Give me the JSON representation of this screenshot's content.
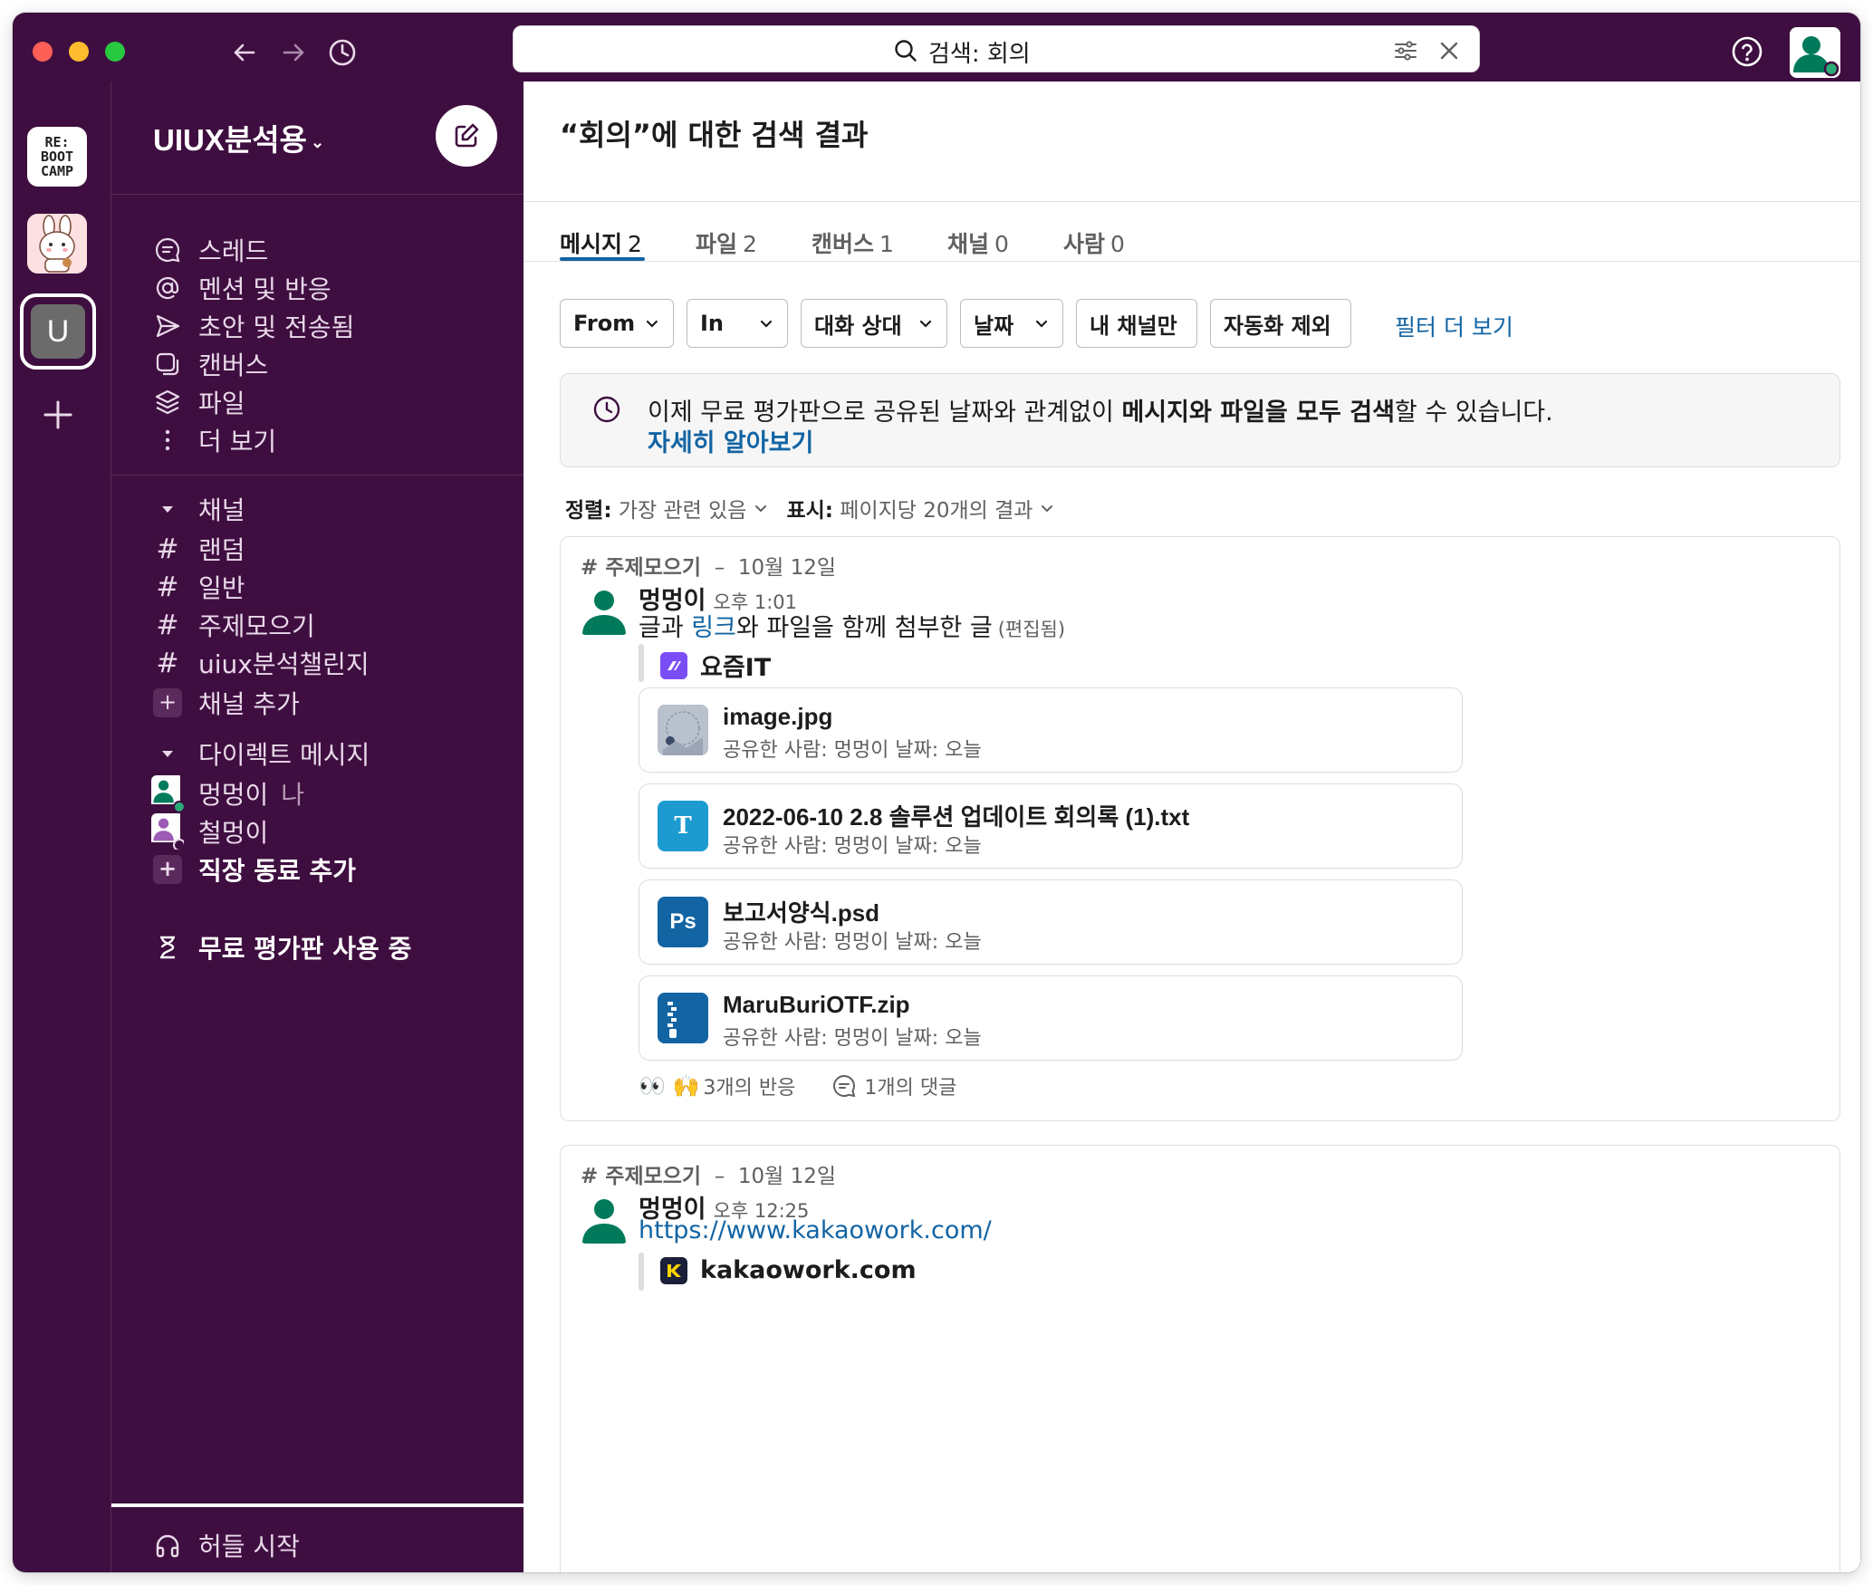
{
  "search": {
    "query": "검색: 회의"
  },
  "rail": {
    "workspace_logo_text": "RE:\nBOOT\nCAMP",
    "current_ws_initial": "U"
  },
  "sidebar": {
    "workspace_name": "UIUX분석용",
    "nav": [
      {
        "label": "스레드",
        "icon": "threads-icon"
      },
      {
        "label": "멘션 및 반응",
        "icon": "mention-icon"
      },
      {
        "label": "초안 및 전송됨",
        "icon": "send-icon"
      },
      {
        "label": "캔버스",
        "icon": "canvas-icon"
      },
      {
        "label": "파일",
        "icon": "files-icon"
      },
      {
        "label": "더 보기",
        "icon": "more-icon"
      }
    ],
    "channels_header": "채널",
    "channels": [
      "랜덤",
      "일반",
      "주제모으기",
      "uiux분석챌린지"
    ],
    "add_channel": "채널 추가",
    "dm_header": "다이렉트 메시지",
    "dms": [
      {
        "name": "멍멍이",
        "suffix": "나",
        "color": "#007a5a",
        "status": "#2bac76"
      },
      {
        "name": "철멍이",
        "suffix": "",
        "color": "#9e5bb5",
        "status": "#ffffff"
      }
    ],
    "add_coworker": "직장 동료 추가",
    "trial": "무료 평가판 사용 중",
    "huddle": "허들 시작"
  },
  "main": {
    "title": "“회의”에 대한 검색 결과",
    "tabs": [
      {
        "label": "메시지",
        "count": "2"
      },
      {
        "label": "파일",
        "count": "2"
      },
      {
        "label": "캔버스",
        "count": "1"
      },
      {
        "label": "채널",
        "count": "0"
      },
      {
        "label": "사람",
        "count": "0"
      }
    ],
    "filters": [
      "From",
      "In",
      "대화 상대",
      "날짜",
      "내 채널만",
      "자동화 제외"
    ],
    "filter_more": "필터 더 보기",
    "notice": {
      "pre": "이제 무료 평가판으로 공유된 날짜와 관계없이 ",
      "bold": "메시지와 파일을 모두 검색",
      "post": "할 수 있습니다.",
      "link": "자세히 알아보기"
    },
    "sort": {
      "sort_label": "정렬:",
      "sort_value": "가장 관련 있음",
      "view_label": "표시:",
      "view_value": "페이지당 20개의 결과"
    },
    "results": [
      {
        "channel": "# 주제모으기",
        "date": "10월 12일",
        "user": "멍멍이",
        "time": "오후 1:01",
        "text_pre": "글과 ",
        "text_link": "링크",
        "text_post": "와 파일을 함께 첨부한 글",
        "edited": "(편집됨)",
        "attachment": "요즘IT",
        "files": [
          {
            "name": "image.jpg",
            "meta": "공유한 사람: 멍멍이 날짜: 오늘",
            "icon": "image-thumbnail-icon"
          },
          {
            "name": "2022-06-10 2.8 솔루션 업데이트 회의록 (1).txt",
            "meta": "공유한 사람: 멍멍이 날짜: 오늘",
            "icon": "text-file-icon",
            "glyph": "T"
          },
          {
            "name": "보고서양식.psd",
            "meta": "공유한 사람: 멍멍이 날짜: 오늘",
            "icon": "photoshop-file-icon",
            "glyph": "Ps"
          },
          {
            "name": "MaruBuriOTF.zip",
            "meta": "공유한 사람: 멍멍이 날짜: 오늘",
            "icon": "zip-file-icon"
          }
        ],
        "reactions": "👀 🙌",
        "reactions_text": "3개의 반응",
        "comments": "1개의 댓글"
      },
      {
        "channel": "# 주제모으기",
        "date": "10월 12일",
        "user": "멍멍이",
        "time": "오후 12:25",
        "link": "https://www.kakaowork.com/",
        "attachment": "kakaowork.com"
      }
    ]
  },
  "colors": {
    "aubergine": "#3f0e40",
    "link": "#1264a3",
    "tab_active": "#1264a3"
  }
}
